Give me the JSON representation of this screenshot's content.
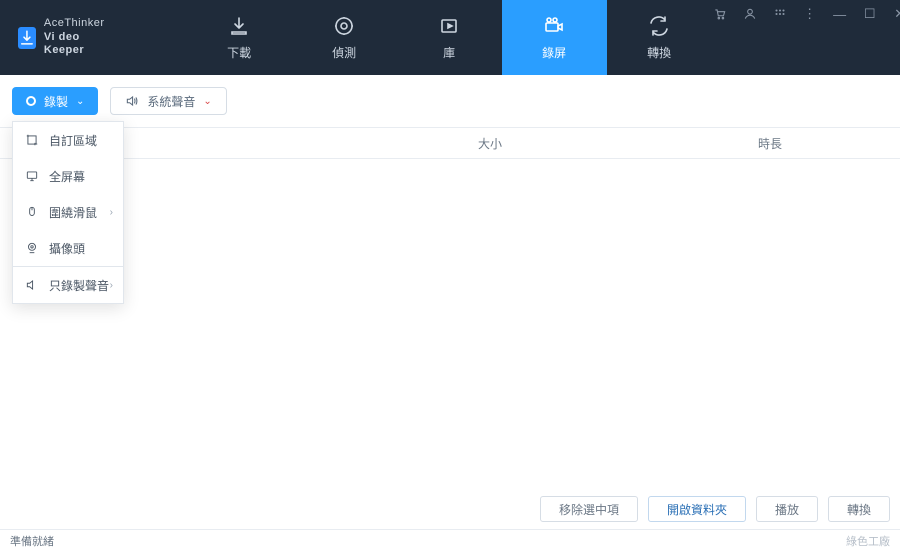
{
  "app": {
    "brand_top": "AceThinker",
    "brand_bottom": "Vi deo  Keeper"
  },
  "nav": {
    "download": "下載",
    "detect": "偵測",
    "library": "庫",
    "record": "錄屏",
    "convert": "轉換"
  },
  "toolbar": {
    "record_label": "錄製",
    "sound_label": "系統聲音"
  },
  "dropdown": {
    "custom_region": "自訂區域",
    "fullscreen": "全屏幕",
    "around_mouse": "圍繞滑鼠",
    "webcam": "攝像頭",
    "audio_only": "只錄製聲音"
  },
  "columns": {
    "size": "大小",
    "duration": "時長"
  },
  "footer": {
    "remove": "移除選中項",
    "open_folder": "開啟資料夾",
    "play": "播放",
    "convert": "轉換"
  },
  "status": {
    "ready": "準備就緒",
    "watermark": "綠色工廠"
  }
}
